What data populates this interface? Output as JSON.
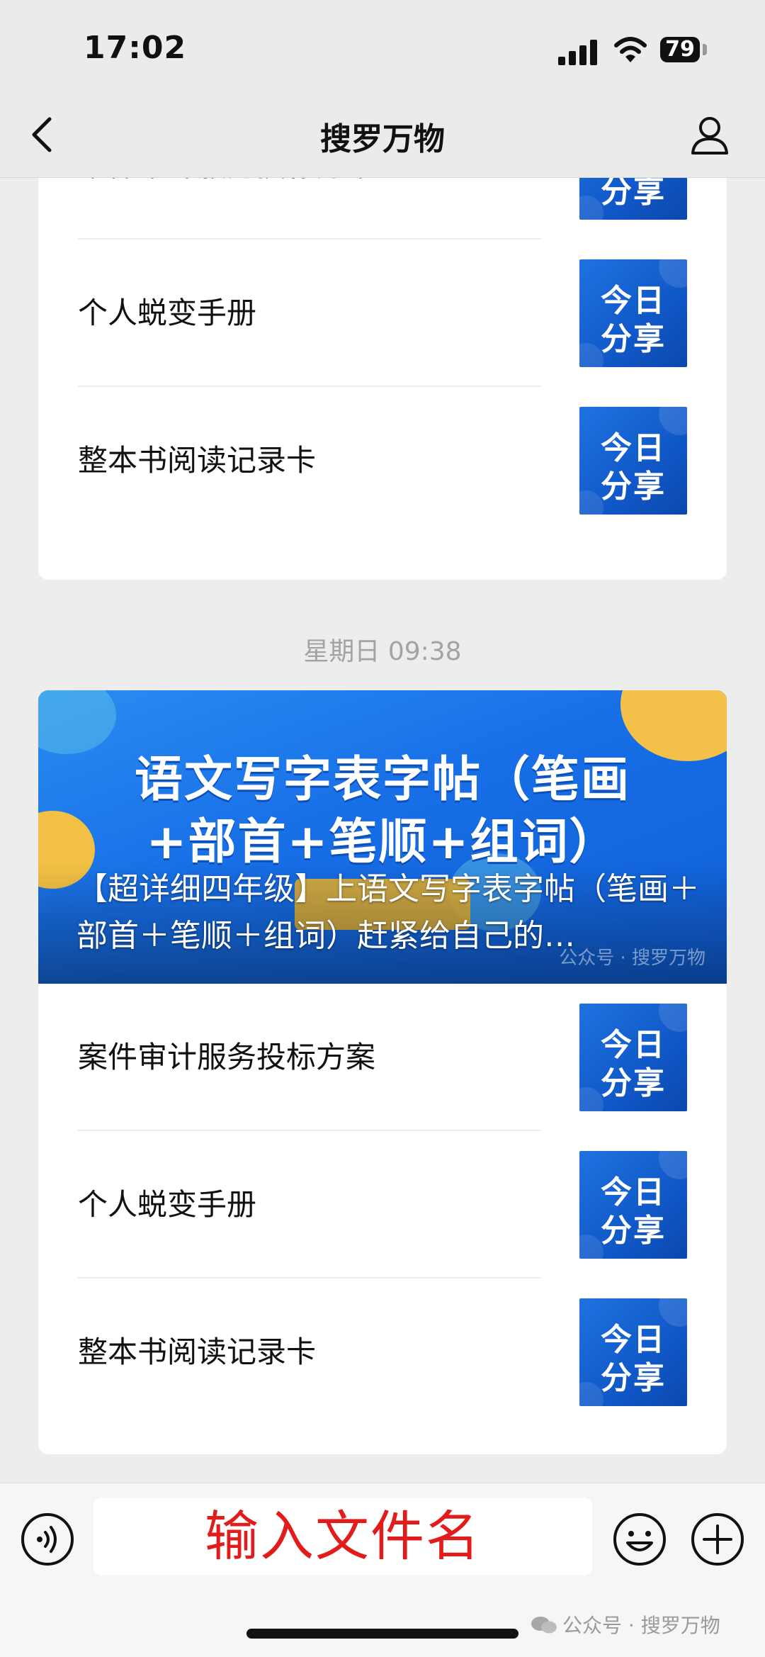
{
  "status_bar": {
    "time": "17:02",
    "battery": "79"
  },
  "nav": {
    "title": "搜罗万物"
  },
  "card1": {
    "items": [
      {
        "label": "案件审计服务投标方案"
      },
      {
        "label": "个人蜕变手册"
      },
      {
        "label": "整本书阅读记录卡"
      }
    ]
  },
  "thumb": {
    "line1": "今日",
    "line2": "分享"
  },
  "timestamp": "星期日 09:38",
  "card2": {
    "banner": {
      "headline_line1": "语文写字表字帖（笔画",
      "headline_line2": "+部首+笔顺+组词）",
      "caption": "【超详细四年级】上语文写字表字帖（笔画＋部首＋笔顺＋组词）赶紧给自己的…",
      "watermark": "公众号 · 搜罗万物"
    },
    "items": [
      {
        "label": "案件审计服务投标方案"
      },
      {
        "label": "个人蜕变手册"
      },
      {
        "label": "整本书阅读记录卡"
      }
    ]
  },
  "input": {
    "placeholder": "输入文件名"
  },
  "footer_watermark": "公众号 · 搜罗万物",
  "colors": {
    "accent_blue": "#1658c9",
    "input_text_red": "#e21b1b"
  }
}
